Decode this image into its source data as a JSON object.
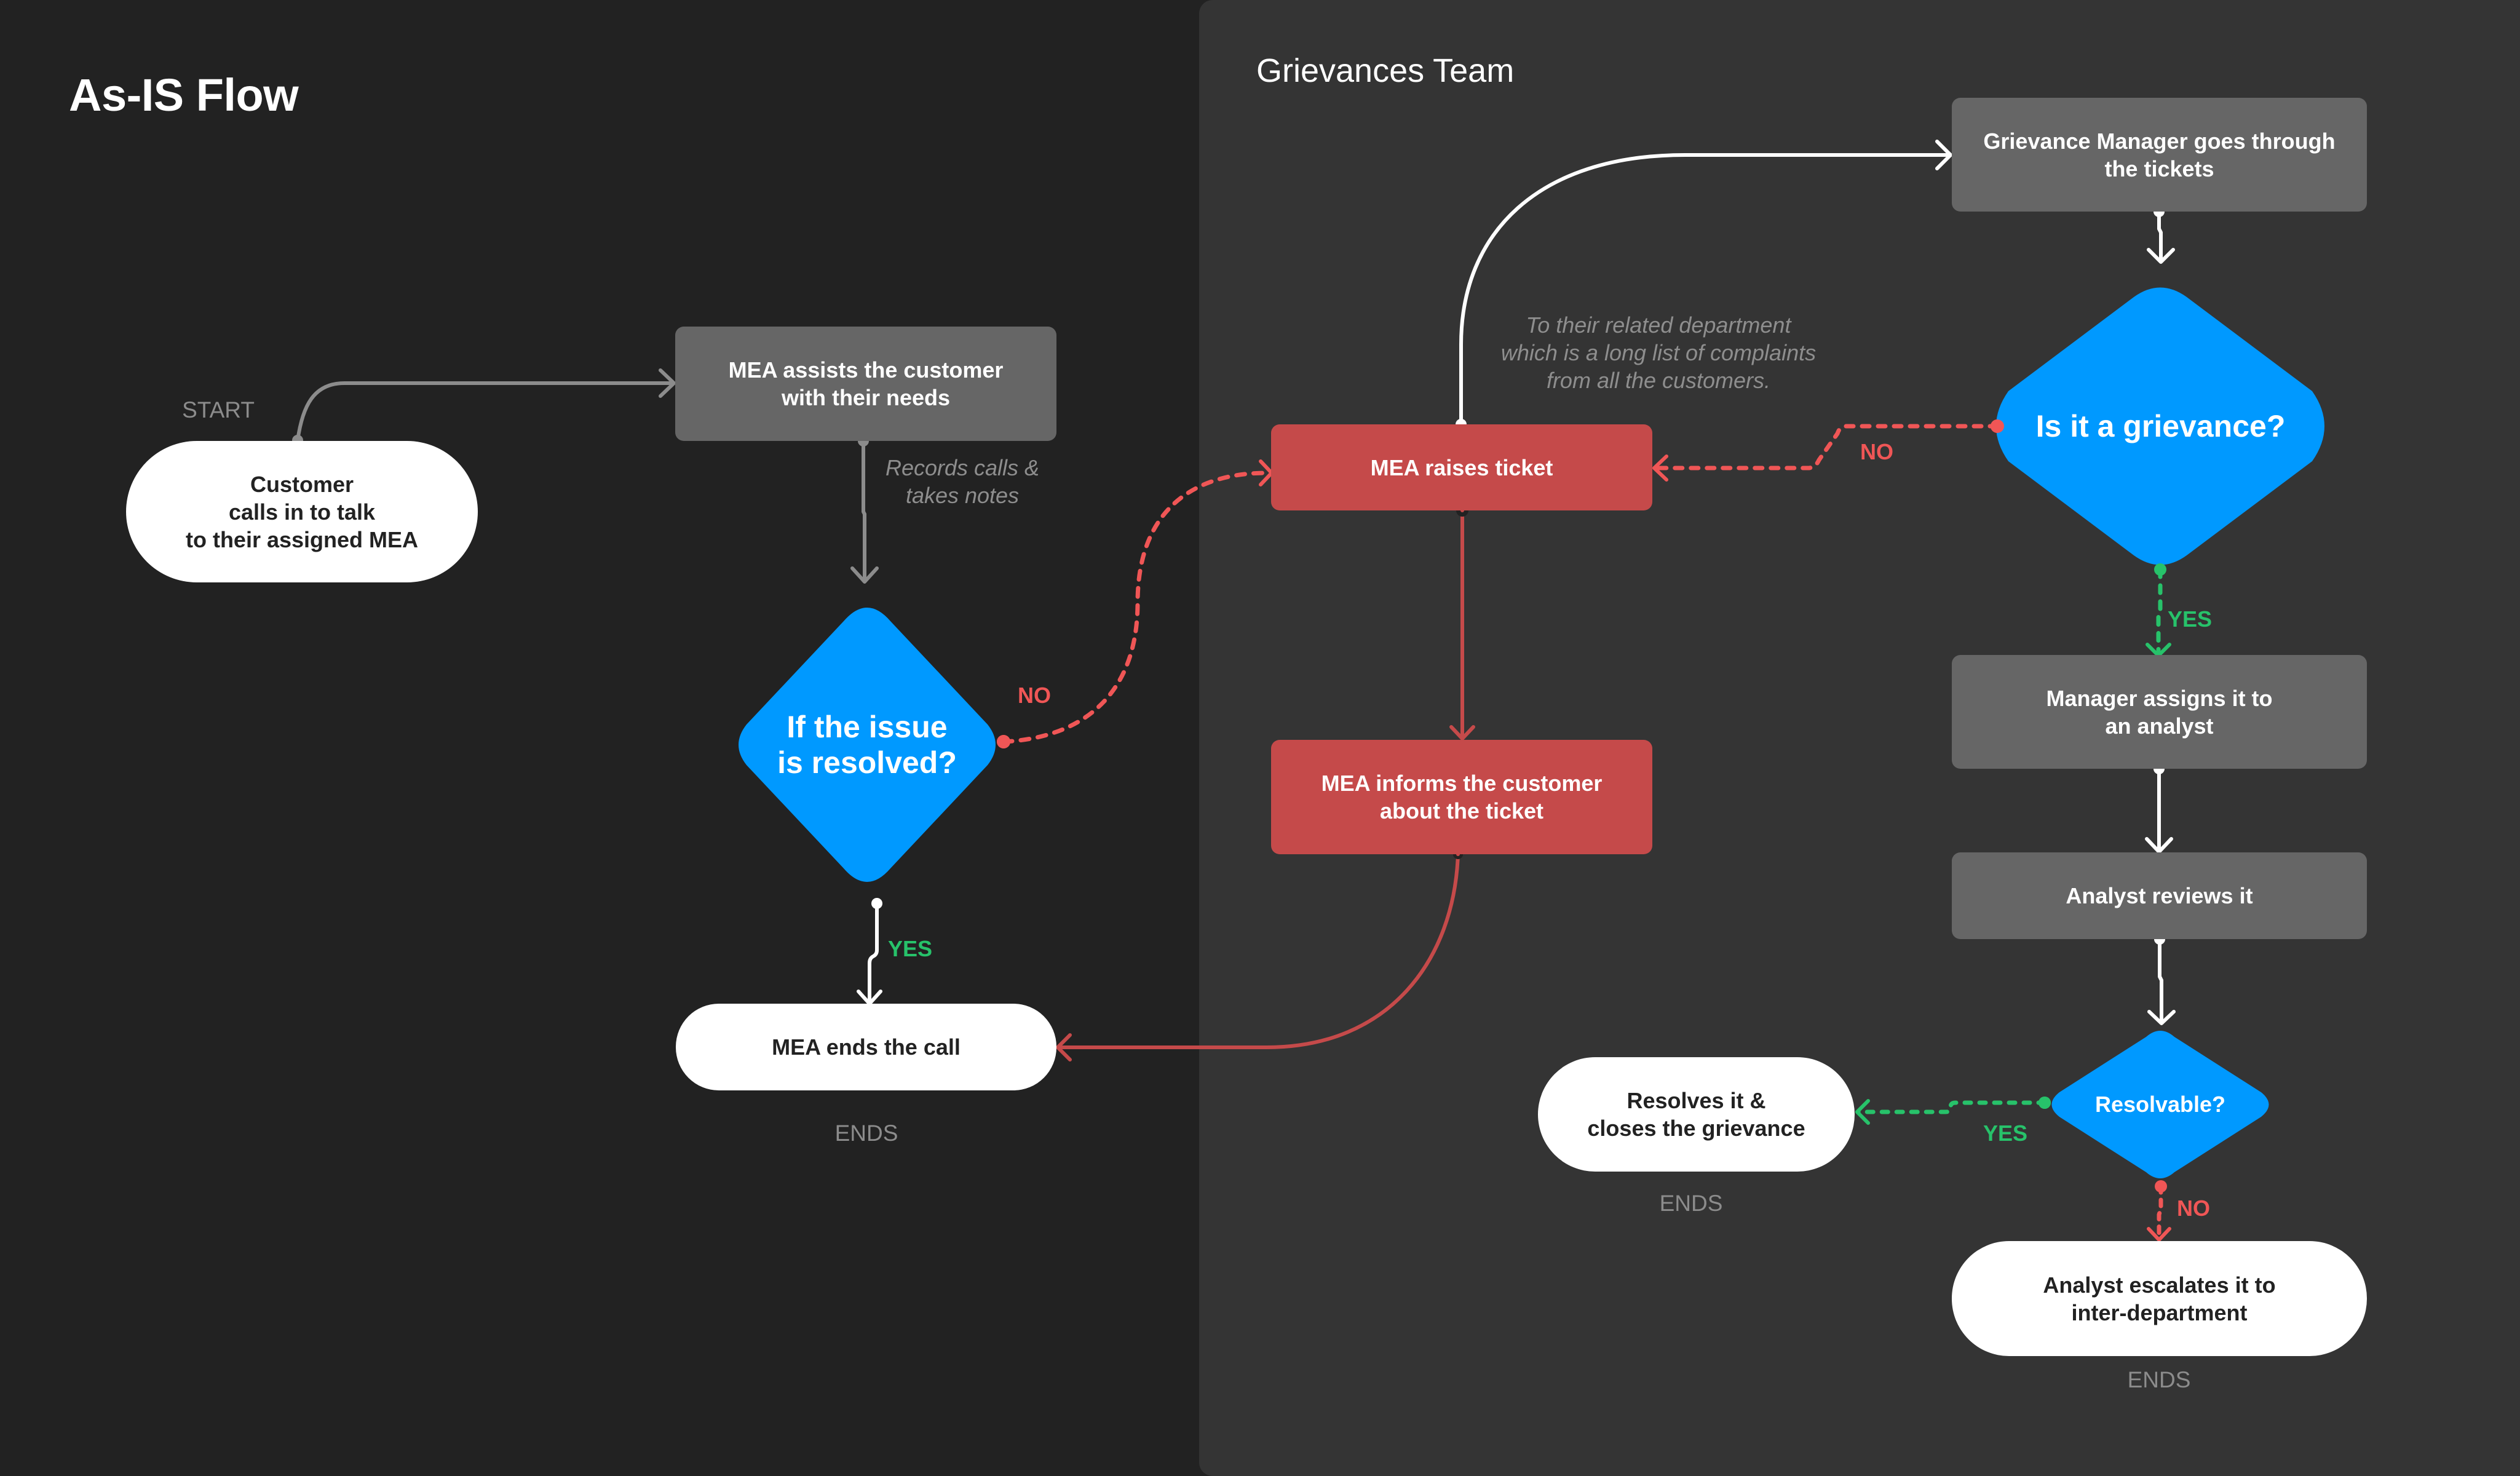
{
  "page": {
    "title": "As-IS Flow",
    "lane_title": "Grievances Team"
  },
  "colors": {
    "background": "#222222",
    "lane_background": "#343434",
    "process_gray": "#666666",
    "process_red": "#C54A4A",
    "decision_blue": "#0099FF",
    "terminal_white": "#FFFFFF",
    "no_red": "#F05656",
    "yes_green": "#27C26A",
    "connector_gray": "#8C8C8C",
    "connector_white": "#FFFFFF",
    "muted_text": "#8C8C8C"
  },
  "nodes": {
    "customer_calls": {
      "type": "terminal",
      "text": "Customer\ncalls in to talk\nto their assigned MEA",
      "caption": "START"
    },
    "mea_assists": {
      "type": "process",
      "text": "MEA assists the customer\nwith their needs"
    },
    "issue_resolved": {
      "type": "decision",
      "text": "If the issue\nis resolved?"
    },
    "mea_ends_call": {
      "type": "terminal",
      "text": "MEA ends the call",
      "caption": "ENDS"
    },
    "mea_raises_ticket": {
      "type": "process",
      "text": "MEA raises ticket"
    },
    "mea_informs": {
      "type": "process",
      "text": "MEA informs the customer\nabout the ticket"
    },
    "manager_goes_through": {
      "type": "process",
      "text": "Grievance Manager goes through\nthe tickets"
    },
    "is_grievance": {
      "type": "decision",
      "text": "Is it a grievance?"
    },
    "manager_assigns": {
      "type": "process",
      "text": "Manager assigns it to\nan analyst"
    },
    "analyst_reviews": {
      "type": "process",
      "text": "Analyst reviews it"
    },
    "resolvable": {
      "type": "decision",
      "text": "Resolvable?"
    },
    "resolves_closes": {
      "type": "terminal",
      "text": "Resolves it &\ncloses the grievance",
      "caption": "ENDS"
    },
    "analyst_escalates": {
      "type": "terminal",
      "text": "Analyst escalates it to\ninter-department",
      "caption": "ENDS"
    }
  },
  "annotations": {
    "records_calls": "Records calls &\ntakes notes",
    "to_department": "To their related department\nwhich is a long list of complaints\nfrom all the customers."
  },
  "branch_labels": {
    "issue_resolved_no": "NO",
    "issue_resolved_yes": "YES",
    "is_grievance_no": "NO",
    "is_grievance_yes": "YES",
    "resolvable_yes": "YES",
    "resolvable_no": "NO"
  },
  "edges": [
    {
      "from": "customer_calls",
      "to": "mea_assists",
      "style": "solid",
      "color": "gray"
    },
    {
      "from": "mea_assists",
      "to": "issue_resolved",
      "style": "solid",
      "color": "gray",
      "label": "Records calls & takes notes"
    },
    {
      "from": "issue_resolved",
      "to": "mea_ends_call",
      "style": "solid",
      "color": "white",
      "label": "YES"
    },
    {
      "from": "issue_resolved",
      "to": "mea_raises_ticket",
      "style": "dashed",
      "color": "red",
      "label": "NO"
    },
    {
      "from": "mea_raises_ticket",
      "to": "manager_goes_through",
      "style": "solid",
      "color": "white",
      "label": "To their related department which is a long list of complaints from all the customers."
    },
    {
      "from": "mea_raises_ticket",
      "to": "mea_informs",
      "style": "solid",
      "color": "red"
    },
    {
      "from": "mea_informs",
      "to": "mea_ends_call",
      "style": "solid",
      "color": "red"
    },
    {
      "from": "manager_goes_through",
      "to": "is_grievance",
      "style": "solid",
      "color": "white"
    },
    {
      "from": "is_grievance",
      "to": "mea_raises_ticket",
      "style": "dashed",
      "color": "red",
      "label": "NO"
    },
    {
      "from": "is_grievance",
      "to": "manager_assigns",
      "style": "dashed",
      "color": "green",
      "label": "YES"
    },
    {
      "from": "manager_assigns",
      "to": "analyst_reviews",
      "style": "solid",
      "color": "white"
    },
    {
      "from": "analyst_reviews",
      "to": "resolvable",
      "style": "solid",
      "color": "white"
    },
    {
      "from": "resolvable",
      "to": "resolves_closes",
      "style": "dashed",
      "color": "green",
      "label": "YES"
    },
    {
      "from": "resolvable",
      "to": "analyst_escalates",
      "style": "dashed",
      "color": "red",
      "label": "NO"
    }
  ]
}
